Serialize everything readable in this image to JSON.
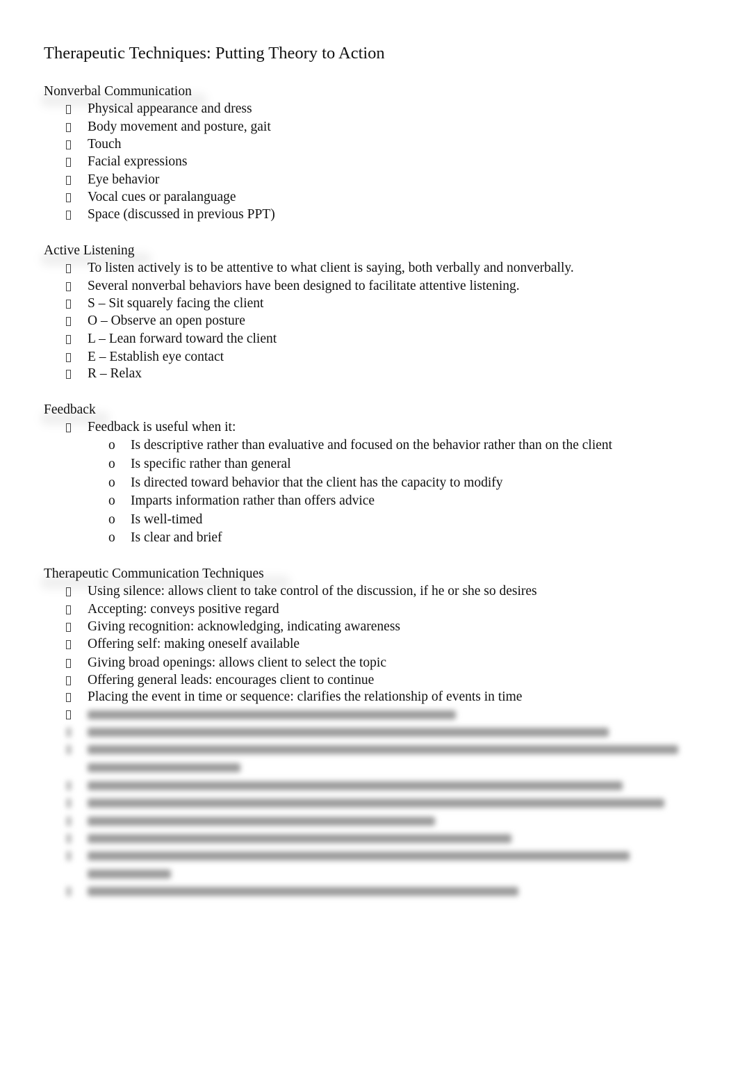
{
  "document": {
    "title": "Therapeutic Techniques: Putting Theory to Action",
    "bullet_icon": "missing-glyph-box",
    "sub_bullet_glyph": "o",
    "sections": [
      {
        "heading": "Nonverbal Communication",
        "items": [
          "Physical appearance and dress",
          "Body movement and posture, gait",
          "Touch",
          "Facial expressions",
          "Eye behavior",
          "Vocal cues or paralanguage",
          "Space (discussed in previous PPT)"
        ]
      },
      {
        "heading": "Active Listening",
        "items": [
          "To listen actively is to be attentive to what client is saying, both verbally and nonverbally.",
          "Several nonverbal behaviors have been designed to facilitate attentive listening.",
          "S – Sit squarely facing the client",
          "O – Observe an open posture",
          "L – Lean forward toward the client",
          "E – Establish eye contact",
          "R – Relax"
        ]
      },
      {
        "heading": "Feedback",
        "items": [
          "Feedback is useful when it:"
        ],
        "sub_items": [
          "Is descriptive rather than evaluative and focused on the behavior rather than on the client",
          "Is specific rather than general",
          "Is directed toward behavior that the client has the capacity to modify",
          "Imparts information rather than offers advice",
          "Is well-timed",
          "Is clear and brief"
        ]
      },
      {
        "heading": "Therapeutic Communication Techniques",
        "items": [
          "Using silence: allows client to take control of the discussion, if he or she so desires",
          "Accepting: conveys positive regard",
          "Giving recognition: acknowledging, indicating awareness",
          "Offering self: making oneself available",
          "Giving broad openings: allows client to select the topic",
          "Offering general leads: encourages client to continue",
          "Placing the event in time or sequence: clarifies the relationship of events in time"
        ],
        "obscured_items_count": 9,
        "obscured_note": "remaining list items are blurred / not legible"
      }
    ]
  }
}
